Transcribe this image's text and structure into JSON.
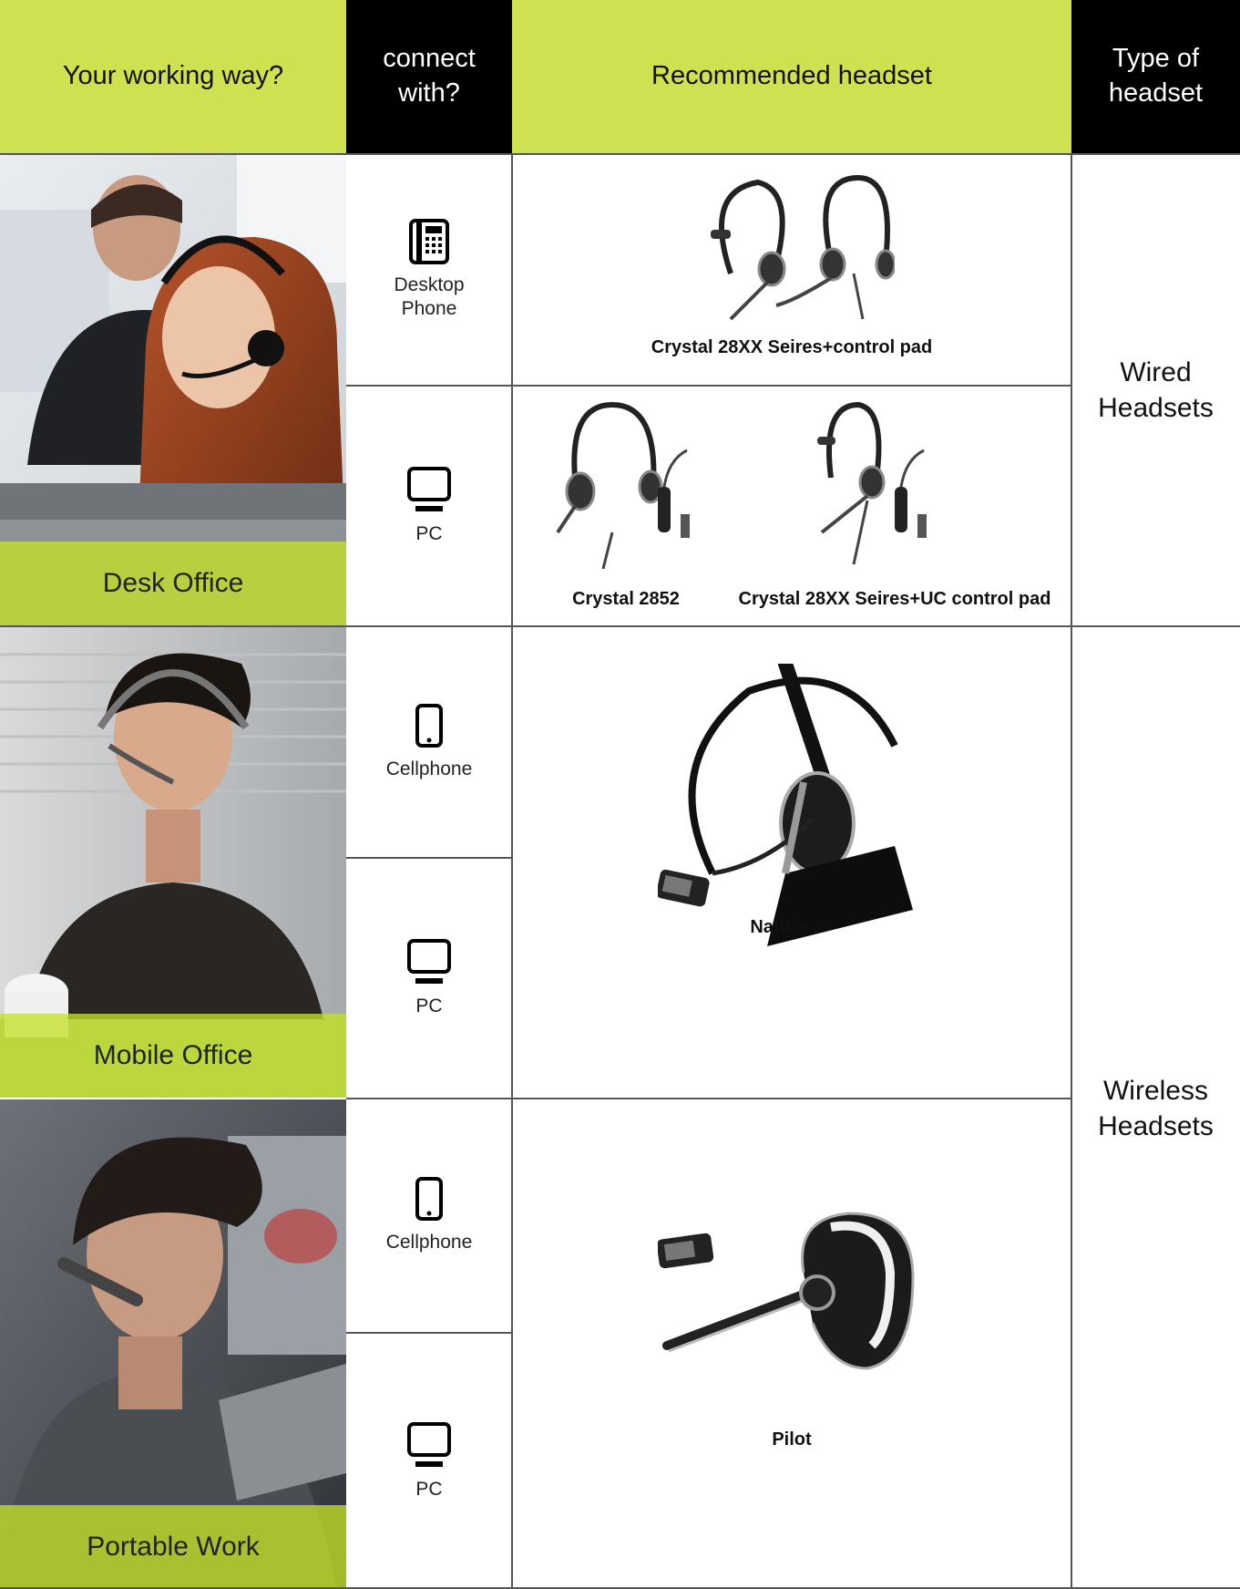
{
  "header": {
    "col1": "Your working way?",
    "col2_line1": "connect",
    "col2_line2": "with?",
    "col3": "Recommended headset",
    "col4_line1": "Type of",
    "col4_line2": "headset"
  },
  "rows": [
    {
      "working_way": "Desk Office",
      "connections": [
        {
          "label_line1": "Desktop",
          "label_line2": "Phone",
          "icon": "desk-phone-icon"
        },
        {
          "label_line1": "PC",
          "label_line2": "",
          "icon": "monitor-icon"
        }
      ]
    },
    {
      "working_way": "Mobile Office",
      "connections": [
        {
          "label_line1": "Cellphone",
          "label_line2": "",
          "icon": "cellphone-icon"
        },
        {
          "label_line1": "PC",
          "label_line2": "",
          "icon": "monitor-icon"
        }
      ]
    },
    {
      "working_way": "Portable Work",
      "connections": [
        {
          "label_line1": "Cellphone",
          "label_line2": "",
          "icon": "cellphone-icon"
        },
        {
          "label_line1": "PC",
          "label_line2": "",
          "icon": "monitor-icon"
        }
      ]
    }
  ],
  "products": {
    "desk_phone": "Crystal 28XX Seires+control pad",
    "pc_a": "Crystal 2852",
    "pc_b": "Crystal 28XX Seires+UC control pad",
    "nature": "Nature",
    "pilot": "Pilot"
  },
  "types": {
    "wired_line1": "Wired",
    "wired_line2": "Headsets",
    "wireless_line1": "Wireless",
    "wireless_line2": "Headsets"
  },
  "colors": {
    "accent_green": "#cfe050",
    "header_black": "#000000"
  }
}
